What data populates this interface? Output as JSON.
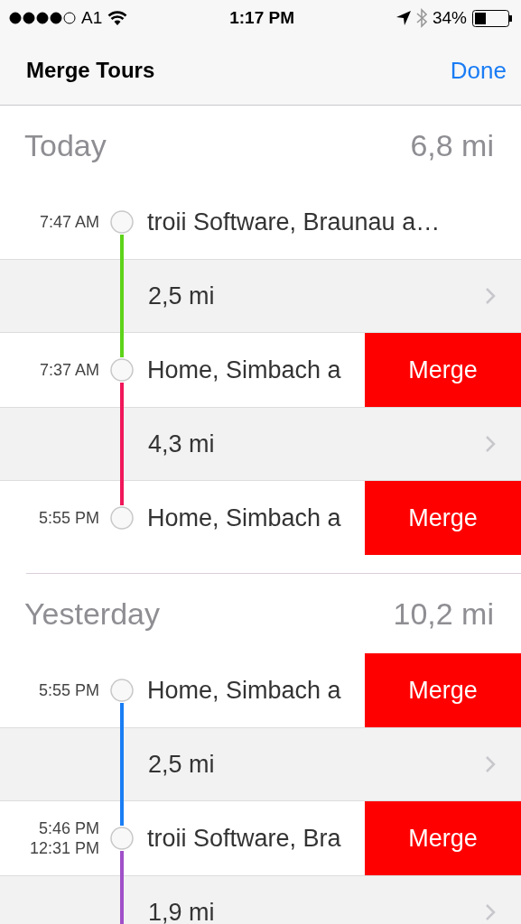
{
  "status_bar": {
    "carrier": "A1",
    "time": "1:17 PM",
    "battery": "34%"
  },
  "nav": {
    "title": "Merge Tours",
    "done": "Done"
  },
  "sections": [
    {
      "title": "Today",
      "total": "6,8 mi",
      "items": [
        {
          "kind": "stop",
          "times": [
            "7:47 AM"
          ],
          "place": "troii Software, Braunau a…"
        },
        {
          "kind": "segment",
          "distance": "2,5 mi",
          "color": "#5ed31a"
        },
        {
          "kind": "stop",
          "times": [
            "7:37 AM"
          ],
          "place": "Home, Simbach a",
          "action": "Merge"
        },
        {
          "kind": "segment",
          "distance": "4,3 mi",
          "color": "#f0185a"
        },
        {
          "kind": "stop",
          "times": [
            "5:55 PM"
          ],
          "place": "Home, Simbach a",
          "action": "Merge"
        }
      ]
    },
    {
      "title": "Yesterday",
      "total": "10,2 mi",
      "items": [
        {
          "kind": "stop",
          "times": [
            "5:55 PM"
          ],
          "place": "Home, Simbach a",
          "action": "Merge"
        },
        {
          "kind": "segment",
          "distance": "2,5 mi",
          "color": "#1a7ef5"
        },
        {
          "kind": "stop",
          "times": [
            "5:46 PM",
            "12:31 PM"
          ],
          "place": "troii Software, Bra",
          "action": "Merge"
        },
        {
          "kind": "segment",
          "distance": "1,9 mi",
          "color": "#a050c8"
        }
      ]
    }
  ]
}
